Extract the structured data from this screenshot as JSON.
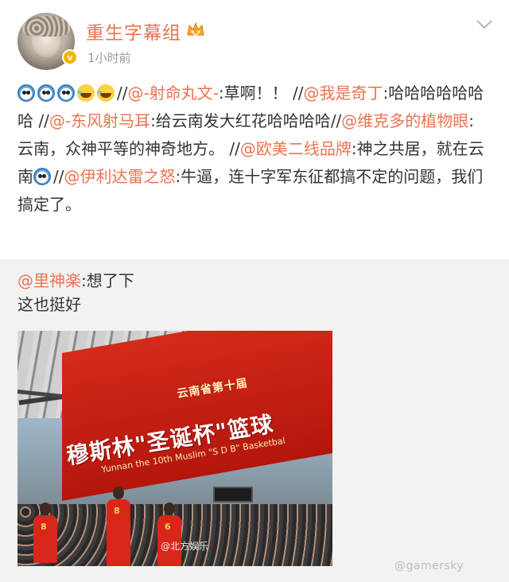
{
  "header": {
    "username": "重生字幕组",
    "timestamp": "1小时前",
    "verified_badge": "v",
    "username_color": "#eb7350"
  },
  "post": {
    "emojis": [
      "cry-icon",
      "cry-icon",
      "cry-icon",
      "laugh-cry-icon",
      "laugh-cry-icon"
    ],
    "segments": {
      "s1": "//",
      "m1": "@-射命丸文-",
      "t1": ":草啊！！",
      "s2": "//",
      "m2": "@我是奇丁",
      "t2": ":哈哈哈哈哈哈哈",
      "s3": "//",
      "m3": "@-东风射马耳",
      "t3": ":给云南发大红花哈哈哈哈",
      "s4": "//",
      "m4": "@维克多的植物眼",
      "t4": ": 云南，众神平等的神奇地方。",
      "s5": "//",
      "m5": "@欧美二线品牌",
      "t5": ":神之共居，就在云南",
      "s6": "//",
      "m6": "@伊利达雷之怒",
      "t6": ":牛逼，连十字军东征都搞不定的问题，我们搞定了。"
    }
  },
  "repost": {
    "mention": "@里神楽",
    "text1": ":想了下",
    "text2": "这也挺好",
    "image": {
      "banner_line1": "云南省第十届",
      "banner_line2": "穆斯林\"圣诞杯\"篮球",
      "banner_line3": "Yunnan the 10th Muslim \"S D B\" Basketbal",
      "watermark": "@北方娱乐",
      "player_numbers": [
        "8",
        "8",
        "6"
      ]
    }
  },
  "site_mark": "@gamersky"
}
